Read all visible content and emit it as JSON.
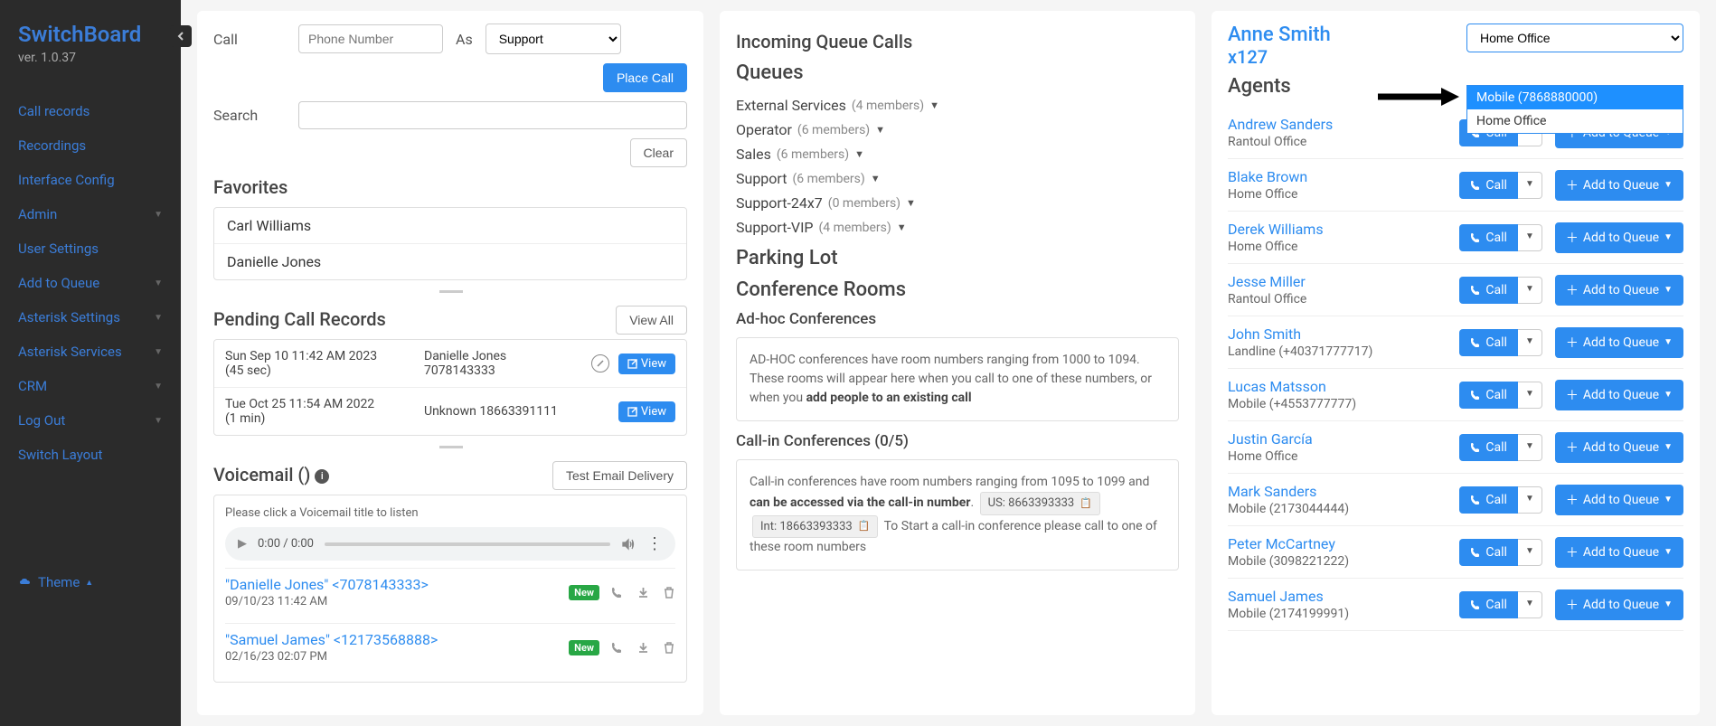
{
  "brand": {
    "title": "SwitchBoard",
    "version": "ver. 1.0.37"
  },
  "nav": {
    "items": [
      {
        "label": "Call records",
        "expandable": false
      },
      {
        "label": "Recordings",
        "expandable": false
      },
      {
        "label": "Interface Config",
        "expandable": false
      },
      {
        "label": "Admin",
        "expandable": true
      },
      {
        "label": "User Settings",
        "expandable": false
      },
      {
        "label": "Add to Queue",
        "expandable": true
      },
      {
        "label": "Asterisk Settings",
        "expandable": true
      },
      {
        "label": "Asterisk Services",
        "expandable": true
      },
      {
        "label": "CRM",
        "expandable": true
      },
      {
        "label": "Log Out",
        "expandable": true
      },
      {
        "label": "Switch Layout",
        "expandable": false
      }
    ],
    "theme_label": "Theme"
  },
  "call_panel": {
    "call_label": "Call",
    "phone_placeholder": "Phone Number",
    "as_label": "As",
    "as_selected": "Support",
    "place_call": "Place Call",
    "search_label": "Search",
    "clear": "Clear"
  },
  "favorites": {
    "heading": "Favorites",
    "items": [
      "Carl Williams",
      "Danielle Jones"
    ]
  },
  "pending": {
    "heading": "Pending Call Records",
    "view_all": "View All",
    "view": "View",
    "rows": [
      {
        "date": "Sun Sep 10 11:42 AM 2023",
        "duration": "(45 sec)",
        "caller": "Danielle Jones",
        "number": "7078143333",
        "blocked": true
      },
      {
        "date": "Tue Oct 25 11:54 AM 2022",
        "duration": "(1 min)",
        "caller": "Unknown 18663391111",
        "number": "",
        "blocked": false
      }
    ]
  },
  "voicemail": {
    "heading": "Voicemail ()",
    "test_email": "Test Email Delivery",
    "hint": "Please click a Voicemail title to listen",
    "audio_time": "0:00 / 0:00",
    "new_badge": "New",
    "items": [
      {
        "title": "\"Danielle Jones\" <7078143333>",
        "date": "09/10/23 11:42 AM"
      },
      {
        "title": "\"Samuel James\" <12173568888>",
        "date": "02/16/23 02:07 PM"
      }
    ]
  },
  "queues_panel": {
    "incoming_heading": "Incoming Queue Calls",
    "queues_heading": "Queues",
    "queues": [
      {
        "name": "External Services",
        "members": "(4 members)"
      },
      {
        "name": "Operator",
        "members": "(6 members)"
      },
      {
        "name": "Sales",
        "members": "(6 members)"
      },
      {
        "name": "Support",
        "members": "(6 members)"
      },
      {
        "name": "Support-24x7",
        "members": "(0 members)"
      },
      {
        "name": "Support-VIP",
        "members": "(4 members)"
      }
    ],
    "parking_heading": "Parking Lot",
    "conf_heading": "Conference Rooms",
    "adhoc_heading": "Ad-hoc Conferences",
    "adhoc_text1": "AD-HOC conferences have room numbers ranging from 1000 to 1094. These rooms will appear here when you call to one of these numbers, or when you ",
    "adhoc_bold": "add people to an existing call",
    "callin_heading": "Call-in Conferences (0/5)",
    "callin_text1": "Call-in conferences have room numbers ranging from 1095 to 1099 and ",
    "callin_bold1": "can be accessed via the call-in number",
    "callin_text2": ". ",
    "callin_us": "US: 8663393333",
    "callin_int": "Int: 18663393333",
    "callin_text3": " To Start a call-in conference please call to one of these room numbers"
  },
  "user_panel": {
    "name": "Anne Smith",
    "ext": "x127",
    "location_selected": "Home Office",
    "location_options": [
      "Mobile (7868880000)",
      "Home Office"
    ],
    "agents_heading": "Agents",
    "call_label": "Call",
    "addq_label": "Add to Queue",
    "agents": [
      {
        "name": "Andrew Sanders",
        "loc": "Rantoul Office"
      },
      {
        "name": "Blake Brown",
        "loc": "Home Office"
      },
      {
        "name": "Derek Williams",
        "loc": "Home Office"
      },
      {
        "name": "Jesse Miller",
        "loc": "Rantoul Office"
      },
      {
        "name": "John Smith",
        "loc": "Landline (+40371777717)"
      },
      {
        "name": "Lucas Matsson",
        "loc": "Mobile (+4553777777)"
      },
      {
        "name": "Justin García",
        "loc": "Home Office"
      },
      {
        "name": "Mark Sanders",
        "loc": "Mobile (2173044444)"
      },
      {
        "name": "Peter McCartney",
        "loc": "Mobile (3098221222)"
      },
      {
        "name": "Samuel James",
        "loc": "Mobile (2174199991)"
      }
    ]
  }
}
